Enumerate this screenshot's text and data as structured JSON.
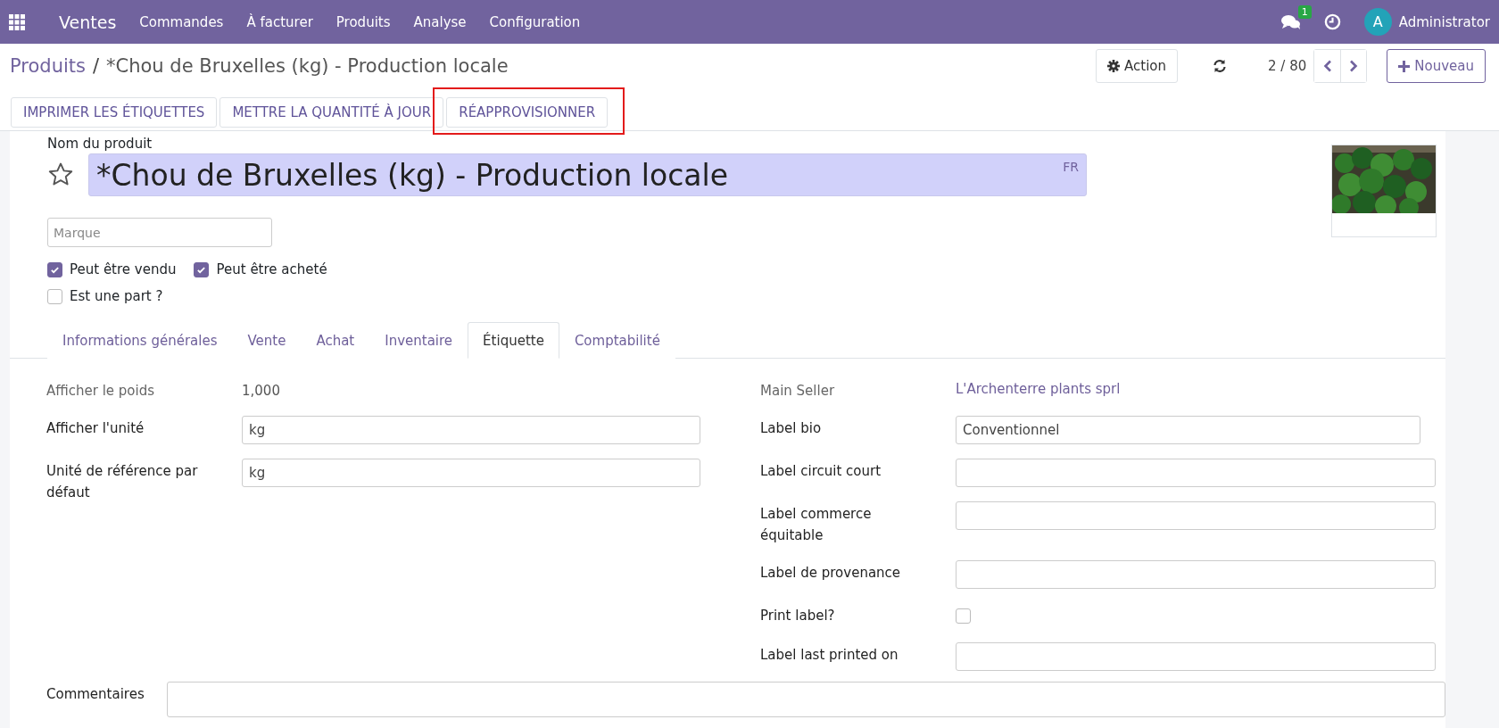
{
  "navbar": {
    "brand": "Ventes",
    "menu": [
      "Commandes",
      "À facturer",
      "Produits",
      "Analyse",
      "Configuration"
    ],
    "messages_count": "1",
    "user_initial": "A",
    "user_name": "Administrator"
  },
  "breadcrumb": {
    "separator": "/",
    "items": [
      "Produits",
      "*Chou de Bruxelles (kg) - Production locale"
    ]
  },
  "control_panel": {
    "action": "Action",
    "pager": "2 / 80",
    "new": "Nouveau"
  },
  "buttons": [
    {
      "label": "IMPRIMER LES ÉTIQUETTES",
      "highlighted": false
    },
    {
      "label": "METTRE LA QUANTITÉ À JOUR",
      "highlighted": false
    },
    {
      "label": "RÉAPPROVISIONNER",
      "highlighted": true
    }
  ],
  "product": {
    "name_label": "Nom du produit",
    "name": "*Chou de Bruxelles (kg) - Production locale",
    "lang": "FR",
    "favorite": false,
    "brand_placeholder": "Marque",
    "flags": [
      {
        "label": "Peut être vendu",
        "checked": true
      },
      {
        "label": "Peut être acheté",
        "checked": true
      },
      {
        "label": "Est une part ?",
        "checked": false
      }
    ]
  },
  "tabs": [
    {
      "label": "Informations générales",
      "selected": false
    },
    {
      "label": "Vente",
      "selected": false
    },
    {
      "label": "Achat",
      "selected": false
    },
    {
      "label": "Inventaire",
      "selected": false
    },
    {
      "label": "Étiquette",
      "selected": true
    },
    {
      "label": "Comptabilité",
      "selected": false
    }
  ],
  "left_fields": [
    {
      "label": "Afficher le poids",
      "kind": "readonly",
      "value": "1,000"
    },
    {
      "label": "Afficher l'unité",
      "kind": "input",
      "value": "kg"
    },
    {
      "label": "Unité de référence par défaut",
      "kind": "input",
      "value": "kg"
    }
  ],
  "right_fields": [
    {
      "label": "Main Seller",
      "kind": "link",
      "value": "L'Archenterre plants sprl"
    },
    {
      "label": "Label bio",
      "kind": "select",
      "value": "Conventionnel"
    },
    {
      "label": "Label circuit court",
      "kind": "input"
    },
    {
      "label": "Label commerce équitable",
      "kind": "input"
    },
    {
      "label": "Label de provenance",
      "kind": "input"
    },
    {
      "label": "Print label?",
      "kind": "checkbox",
      "checked": false
    },
    {
      "label": "Label last printed on",
      "kind": "input"
    }
  ],
  "comments": {
    "label": "Commentaires"
  }
}
